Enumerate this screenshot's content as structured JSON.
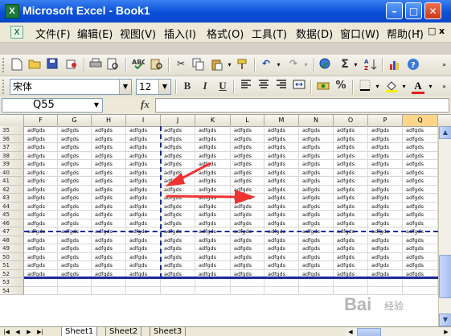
{
  "window": {
    "title": "Microsoft Excel - Book1",
    "app_icon": "excel-icon",
    "controls": [
      "minimize",
      "maximize",
      "close"
    ]
  },
  "menubar": {
    "items": [
      "文件(F)",
      "编辑(E)",
      "视图(V)",
      "插入(I)",
      "格式(O)",
      "工具(T)",
      "数据(D)",
      "窗口(W)",
      "帮助(H)"
    ],
    "doc_controls": [
      "-",
      "□",
      "x"
    ]
  },
  "toolbar_standard": {
    "icons": [
      "new-icon",
      "open-icon",
      "save-icon",
      "permission-icon",
      "print-icon",
      "print-preview-icon",
      "spelling-icon",
      "research-icon",
      "cut-icon",
      "copy-icon",
      "paste-icon",
      "format-painter-icon",
      "undo-icon",
      "redo-icon",
      "hyperlink-icon",
      "autosum-icon",
      "sort-ascending-icon",
      "chart-wizard-icon",
      "help-icon"
    ]
  },
  "toolbar_format": {
    "font_name": "宋体",
    "font_size": "12",
    "bold": "B",
    "italic": "I",
    "underline": "U",
    "percent": "%",
    "font_color_letter": "A"
  },
  "formula_bar": {
    "name_box": "Q55",
    "fx_label": "fx",
    "formula": ""
  },
  "grid": {
    "columns": [
      "F",
      "G",
      "H",
      "I",
      "J",
      "K",
      "L",
      "M",
      "N",
      "O",
      "P",
      "Q"
    ],
    "active_column": "Q",
    "rows": [
      "35",
      "36",
      "37",
      "38",
      "39",
      "40",
      "41",
      "42",
      "43",
      "44",
      "45",
      "46",
      "47",
      "48",
      "49",
      "50",
      "51",
      "52",
      "53",
      "54"
    ],
    "filled_row_count": 18,
    "cell_text": "adfgds"
  },
  "sheets": {
    "tabs": [
      "Sheet1",
      "Sheet2",
      "Sheet3"
    ],
    "active": "Sheet1"
  },
  "watermark": {
    "brand": "Bai",
    "text": "经验"
  },
  "colors": {
    "title_bar": "#0a50d8",
    "page_break": "#1a2a9a",
    "annotation_arrow": "#ee3333",
    "active_header": "#ffd58a"
  }
}
